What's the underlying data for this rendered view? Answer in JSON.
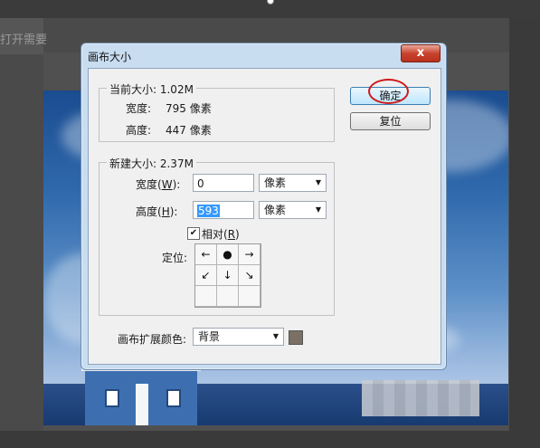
{
  "background": {
    "doc_tab_text": "打开需要",
    "accent_color": "#3399ff"
  },
  "dialog": {
    "title": "画布大小",
    "close_glyph": "x",
    "current": {
      "label": "当前大小: 1.02M",
      "width_label": "宽度:",
      "width_value": "795 像素",
      "height_label": "高度:",
      "height_value": "447 像素"
    },
    "new": {
      "label": "新建大小: 2.37M",
      "width_label": "宽度(",
      "width_key": "W",
      "width_label_end": "):",
      "width_value": "0",
      "width_unit": "像素",
      "height_label": "高度(",
      "height_key": "H",
      "height_label_end": "):",
      "height_value": "593",
      "height_unit": "像素",
      "relative_label": "相对(",
      "relative_key": "R",
      "relative_label_end": ")",
      "relative_checked": true,
      "anchor_label": "定位:",
      "anchor_cells": [
        "←",
        "●",
        "→",
        "↙",
        "↓",
        "↘",
        "",
        "",
        ""
      ]
    },
    "ok_button": "确定",
    "reset_button": "复位",
    "extension_color": {
      "label": "画布扩展颜色:",
      "value": "背景",
      "swatch_color": "#7a7064"
    },
    "highlight_color": "#d01818"
  }
}
